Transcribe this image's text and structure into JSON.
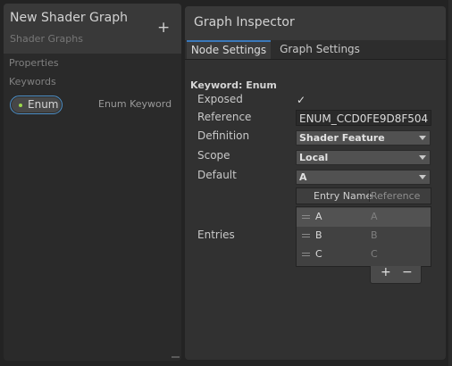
{
  "blackboard": {
    "title": "New Shader Graph",
    "subtitle": "Shader Graphs",
    "add_glyph": "+",
    "sections": {
      "properties": "Properties",
      "keywords": "Keywords"
    },
    "keyword_item": {
      "label": "Enum",
      "type_label": "Enum Keyword",
      "dot_color": "#9bd84b"
    }
  },
  "inspector": {
    "title": "Graph Inspector",
    "tabs": [
      {
        "label": "Node Settings",
        "active": true
      },
      {
        "label": "Graph Settings",
        "active": false
      }
    ],
    "heading": "Keyword: Enum",
    "props": {
      "exposed_label": "Exposed",
      "exposed_check": "✓",
      "reference_label": "Reference",
      "reference_value": "ENUM_CCD0FE9D8F504",
      "definition_label": "Definition",
      "definition_value": "Shader Feature",
      "scope_label": "Scope",
      "scope_value": "Local",
      "default_label": "Default",
      "default_value": "A",
      "entries_label": "Entries"
    },
    "entries": {
      "col_name": "Entry Name",
      "col_ref": "Reference",
      "rows": [
        {
          "name": "A",
          "ref": "A",
          "selected": true
        },
        {
          "name": "B",
          "ref": "B",
          "selected": false
        },
        {
          "name": "C",
          "ref": "C",
          "selected": false
        }
      ],
      "add": "+",
      "remove": "−"
    }
  },
  "colors": {
    "accent": "#3a79bb",
    "pill_border": "#4e90c8"
  }
}
